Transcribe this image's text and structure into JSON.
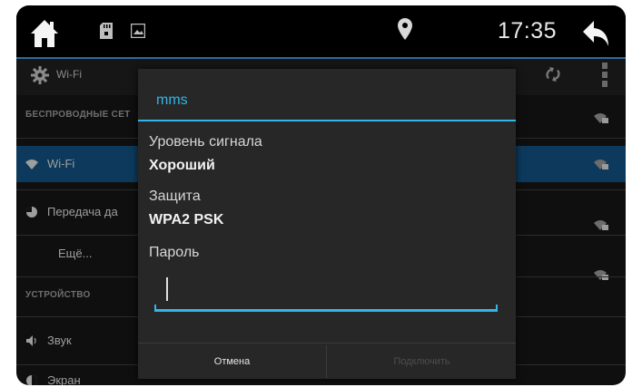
{
  "status_bar": {
    "time": "17:35",
    "icons": [
      "home-icon",
      "sd-card-icon",
      "picture-icon",
      "location-pin-icon",
      "back-arrow-icon"
    ]
  },
  "settings_header": {
    "title": "Wi-Fi",
    "icons": [
      "gear-icon",
      "wifi-scan-icon",
      "overflow-menu-icon"
    ]
  },
  "sidebar": {
    "section_wireless": "БЕСПРОВОДНЫЕ СЕТ",
    "items": [
      {
        "label": "Wi-Fi",
        "icon": "wifi-icon",
        "active": true
      },
      {
        "label": "Передача да",
        "icon": "data-usage-icon",
        "active": false
      },
      {
        "label": "Ещё...",
        "icon": "",
        "active": false
      }
    ],
    "section_device": "УСТРОЙСТВО",
    "device_items": [
      {
        "label": "Звук",
        "icon": "speaker-icon"
      },
      {
        "label": "Экран",
        "icon": "brightness-icon"
      }
    ]
  },
  "networks": {
    "lock_icons": [
      "wifi-lock-icon",
      "wifi-lock-icon",
      "wifi-lock-icon",
      "wifi-lock-icon",
      "wifi-lock-icon"
    ]
  },
  "dialog": {
    "title": "mms",
    "signal_label": "Уровень сигнала",
    "signal_value": "Хороший",
    "security_label": "Защита",
    "security_value": "WPA2 PSK",
    "password_label": "Пароль",
    "password_value": "",
    "cancel_label": "Отмена",
    "connect_label": "Подключить"
  },
  "colors": {
    "accent": "#33b5e5",
    "background": "#0f0f0f",
    "dialog": "#272727",
    "active_item": "#0d3a5c"
  }
}
